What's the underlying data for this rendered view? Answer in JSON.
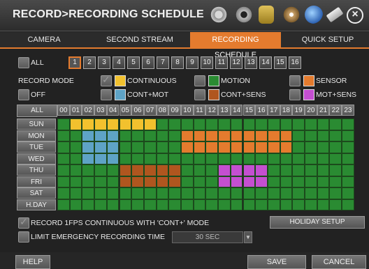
{
  "title": "RECORD>RECORDING SCHEDULE",
  "toolbar_icons": [
    "gear-icon",
    "camera-icon",
    "database-icon",
    "disc-icon",
    "globe-icon",
    "usb-icon"
  ],
  "tabs": [
    "CAMERA",
    "SECOND STREAM",
    "RECORDING SCHEDULE",
    "QUICK SETUP"
  ],
  "active_tab": 2,
  "all_label": "ALL",
  "camera_numbers": [
    "1",
    "2",
    "3",
    "4",
    "5",
    "6",
    "7",
    "8",
    "9",
    "10",
    "11",
    "12",
    "13",
    "14",
    "15",
    "16"
  ],
  "selected_camera": 0,
  "record_mode_label": "RECORD MODE",
  "off_label": "OFF",
  "modes": [
    {
      "label": "CONTINUOUS",
      "color": "#f2c12e",
      "checked": true
    },
    {
      "label": "MOTION",
      "color": "#2a8b32",
      "checked": false
    },
    {
      "label": "SENSOR",
      "color": "#e47b2e",
      "checked": false
    },
    {
      "label": "CONT+MOT",
      "color": "#5ea3c6",
      "checked": false
    },
    {
      "label": "CONT+SENS",
      "color": "#b0561f",
      "checked": false
    },
    {
      "label": "MOT+SENS",
      "color": "#c44fd0",
      "checked": false
    }
  ],
  "grid_all_label": "ALL",
  "hours": [
    "00",
    "01",
    "02",
    "03",
    "04",
    "05",
    "06",
    "07",
    "08",
    "09",
    "10",
    "11",
    "12",
    "13",
    "14",
    "15",
    "16",
    "17",
    "18",
    "19",
    "20",
    "21",
    "22",
    "23"
  ],
  "days": [
    "SUN",
    "MON",
    "TUE",
    "WED",
    "THU",
    "FRI",
    "SAT",
    "H.DAY"
  ],
  "schedule": [
    [
      "M",
      "Y",
      "Y",
      "Y",
      "Y",
      "Y",
      "Y",
      "Y",
      "M",
      "M",
      "M",
      "M",
      "M",
      "M",
      "M",
      "M",
      "M",
      "M",
      "M",
      "M",
      "M",
      "M",
      "M",
      "M"
    ],
    [
      "M",
      "M",
      "B",
      "B",
      "B",
      "M",
      "M",
      "M",
      "M",
      "M",
      "S",
      "S",
      "S",
      "S",
      "S",
      "S",
      "S",
      "S",
      "S",
      "M",
      "M",
      "M",
      "M",
      "M"
    ],
    [
      "M",
      "M",
      "B",
      "B",
      "B",
      "M",
      "M",
      "M",
      "M",
      "M",
      "S",
      "S",
      "S",
      "S",
      "S",
      "S",
      "S",
      "S",
      "S",
      "M",
      "M",
      "M",
      "M",
      "M"
    ],
    [
      "M",
      "M",
      "B",
      "B",
      "B",
      "M",
      "M",
      "M",
      "M",
      "M",
      "M",
      "M",
      "M",
      "M",
      "M",
      "M",
      "M",
      "M",
      "M",
      "M",
      "M",
      "M",
      "M",
      "M"
    ],
    [
      "M",
      "M",
      "M",
      "M",
      "M",
      "C",
      "C",
      "C",
      "C",
      "C",
      "M",
      "M",
      "M",
      "P",
      "P",
      "P",
      "P",
      "M",
      "M",
      "M",
      "M",
      "M",
      "M",
      "M"
    ],
    [
      "M",
      "M",
      "M",
      "M",
      "M",
      "C",
      "C",
      "C",
      "C",
      "C",
      "M",
      "M",
      "M",
      "P",
      "P",
      "P",
      "P",
      "M",
      "M",
      "M",
      "M",
      "M",
      "M",
      "M"
    ],
    [
      "M",
      "M",
      "M",
      "M",
      "M",
      "M",
      "M",
      "M",
      "M",
      "M",
      "M",
      "M",
      "M",
      "M",
      "M",
      "M",
      "M",
      "M",
      "M",
      "M",
      "M",
      "M",
      "M",
      "M"
    ],
    [
      "M",
      "M",
      "M",
      "M",
      "M",
      "M",
      "M",
      "M",
      "M",
      "M",
      "M",
      "M",
      "M",
      "M",
      "M",
      "M",
      "M",
      "M",
      "M",
      "M",
      "M",
      "M",
      "M",
      "M"
    ]
  ],
  "schedule_colors": {
    "M": "#2a8b32",
    "Y": "#f2c12e",
    "B": "#5ea3c6",
    "S": "#e47b2e",
    "C": "#b0561f",
    "P": "#c44fd0"
  },
  "record_1fps_label": "RECORD 1FPS CONTINUOUS WITH 'CONT+' MODE",
  "record_1fps_checked": true,
  "holiday_setup_label": "HOLIDAY SETUP",
  "limit_emergency_label": "LIMIT EMERGENCY RECORDING TIME",
  "limit_emergency_checked": false,
  "limit_value": "30 SEC",
  "help_label": "HELP",
  "save_label": "SAVE",
  "cancel_label": "CANCEL"
}
